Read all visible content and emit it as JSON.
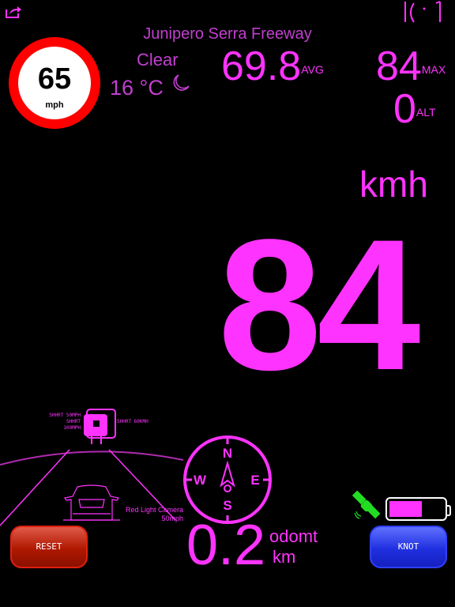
{
  "colors": {
    "accent": "#ff33ff",
    "secondary": "#c23fd0",
    "limit_ring": "#ff0000",
    "reset": "#c01c00",
    "knot": "#2a3ae8",
    "gps": "#22dd22"
  },
  "icons": {
    "share": "share-icon",
    "wifi": "wifi-signal-icon",
    "moon": "moon-icon",
    "satellite": "satellite-icon",
    "battery": "battery-icon",
    "compass": "compass-icon",
    "car": "car-icon",
    "camera": "speed-camera-icon"
  },
  "location": {
    "street": "Junipero Serra Freeway"
  },
  "weather": {
    "condition": "Clear",
    "temperature": "16 °C"
  },
  "speed_limit": {
    "value": "65",
    "unit": "mph"
  },
  "stats": {
    "avg": "69.8",
    "avg_label": "AVG",
    "max": "84",
    "max_label": "MAX",
    "alt": "0",
    "alt_label": "ALT"
  },
  "speed": {
    "unit": "kmh",
    "value": "84"
  },
  "compass": {
    "n": "N",
    "s": "S",
    "e": "E",
    "w": "W"
  },
  "odometer": {
    "value": "0.2",
    "label": "odomt",
    "unit": "km"
  },
  "camera": {
    "left_line1": "SHHRT 50MPH",
    "left_line2": "SHHRT",
    "left_line3": "100MPH",
    "right": "SHHRT 60KMH",
    "alert": "Red Light Camera 50mph"
  },
  "battery": {
    "level": 0.6
  },
  "buttons": {
    "reset": "RESET",
    "knot": "KNOT"
  }
}
